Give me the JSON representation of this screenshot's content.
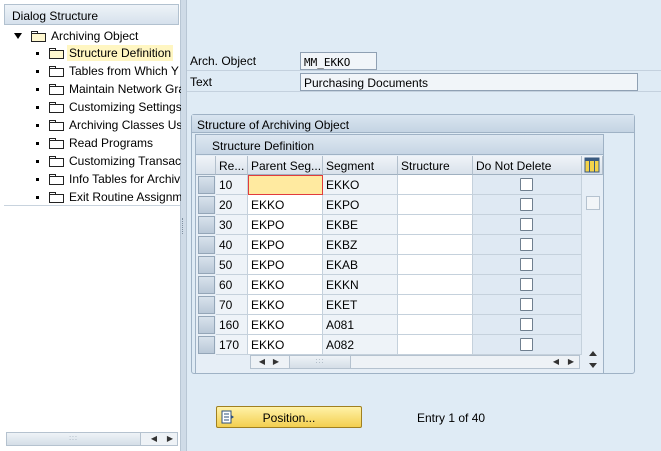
{
  "left_pane": {
    "title": "Dialog Structure",
    "root": "Archiving Object",
    "items": [
      "Structure Definition",
      "Tables from Which Y",
      "Maintain Network Gra",
      "Customizing Settings",
      "Archiving Classes Us",
      "Read Programs",
      "Customizing Transac",
      "Info Tables for Archiv",
      "Exit Routine Assignm"
    ],
    "selected_index": 0
  },
  "header": {
    "arch_object_label": "Arch. Object",
    "arch_object_value": "MM_EKKO",
    "text_label": "Text",
    "text_value": "Purchasing Documents"
  },
  "group": {
    "title": "Structure of Archiving Object",
    "table_title": "Structure Definition",
    "columns": [
      "Re...",
      "Parent Seg...",
      "Segment",
      "Structure",
      "Do Not Delete"
    ],
    "rows": [
      {
        "re": "10",
        "parent": "",
        "segment": "EKKO",
        "structure": "",
        "do_not_delete": false
      },
      {
        "re": "20",
        "parent": "EKKO",
        "segment": "EKPO",
        "structure": "",
        "do_not_delete": false
      },
      {
        "re": "30",
        "parent": "EKPO",
        "segment": "EKBE",
        "structure": "",
        "do_not_delete": false
      },
      {
        "re": "40",
        "parent": "EKPO",
        "segment": "EKBZ",
        "structure": "",
        "do_not_delete": false
      },
      {
        "re": "50",
        "parent": "EKPO",
        "segment": "EKAB",
        "structure": "",
        "do_not_delete": false
      },
      {
        "re": "60",
        "parent": "EKKO",
        "segment": "EKKN",
        "structure": "",
        "do_not_delete": false
      },
      {
        "re": "70",
        "parent": "EKKO",
        "segment": "EKET",
        "structure": "",
        "do_not_delete": false
      },
      {
        "re": "160",
        "parent": "EKKO",
        "segment": "A081",
        "structure": "",
        "do_not_delete": false
      },
      {
        "re": "170",
        "parent": "EKKO",
        "segment": "A082",
        "structure": "",
        "do_not_delete": false
      }
    ]
  },
  "footer": {
    "position_button_label": "Position...",
    "entry_text": "Entry 1 of 40"
  },
  "colors": {
    "background": "#dfebf5",
    "button_yellow": "#f3cf50",
    "focus_cell": "#ffeaa0",
    "selection": "#fff6c2"
  }
}
